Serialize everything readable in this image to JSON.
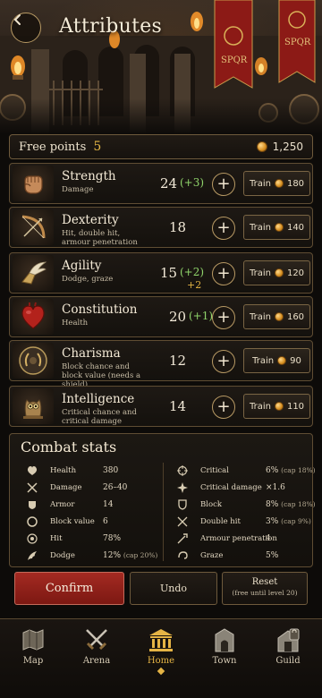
{
  "header": {
    "title": "Attributes",
    "back_icon": "chevron-left-icon"
  },
  "free_points": {
    "label": "Free points",
    "value": "5",
    "gold": "1,250"
  },
  "attributes": [
    {
      "name": "Strength",
      "desc": "Damage",
      "value": "24",
      "bonus": "(+3)",
      "subbonus": "",
      "train_label": "Train",
      "cost": "180",
      "icon": "fist-icon"
    },
    {
      "name": "Dexterity",
      "desc": "Hit, double hit, armour penetration",
      "value": "18",
      "bonus": "",
      "subbonus": "",
      "train_label": "Train",
      "cost": "140",
      "icon": "bow-icon"
    },
    {
      "name": "Agility",
      "desc": "Dodge, graze",
      "value": "15",
      "bonus": "(+2)",
      "subbonus": "+2",
      "train_label": "Train",
      "cost": "120",
      "icon": "winged-boot-icon"
    },
    {
      "name": "Constitution",
      "desc": "Health",
      "value": "20",
      "bonus": "(+1)",
      "subbonus": "",
      "train_label": "Train",
      "cost": "160",
      "icon": "heart-icon"
    },
    {
      "name": "Charisma",
      "desc": "Block chance and block value (needs a shield)",
      "value": "12",
      "bonus": "",
      "subbonus": "",
      "train_label": "Train",
      "cost": "90",
      "icon": "laurel-shield-icon"
    },
    {
      "name": "Intelligence",
      "desc": "Critical chance and critical damage",
      "value": "14",
      "bonus": "",
      "subbonus": "",
      "train_label": "Train",
      "cost": "110",
      "icon": "owl-icon"
    }
  ],
  "combat": {
    "title": "Combat stats",
    "left": [
      {
        "name": "Health",
        "value": "380",
        "cap": "",
        "icon": "heart-icon"
      },
      {
        "name": "Damage",
        "value": "26–40",
        "cap": "",
        "icon": "crossed-swords-icon"
      },
      {
        "name": "Armor",
        "value": "14",
        "cap": "",
        "icon": "armor-icon"
      },
      {
        "name": "Block value",
        "value": "6",
        "cap": "",
        "icon": "shield-icon"
      },
      {
        "name": "Hit",
        "value": "78%",
        "cap": "",
        "icon": "target-icon"
      },
      {
        "name": "Dodge",
        "value": "12%",
        "cap": "(cap 20%)",
        "icon": "wing-icon"
      }
    ],
    "right": [
      {
        "name": "Critical",
        "value": "6%",
        "cap": "(cap 18%)",
        "icon": "crosshair-icon"
      },
      {
        "name": "Critical damage",
        "value": "×1.6",
        "cap": "",
        "icon": "burst-icon"
      },
      {
        "name": "Block",
        "value": "8%",
        "cap": "(cap 18%)",
        "icon": "shield-icon"
      },
      {
        "name": "Double hit",
        "value": "3%",
        "cap": "(cap 9%)",
        "icon": "double-swords-icon"
      },
      {
        "name": "Armour penetration",
        "value": "4",
        "cap": "",
        "icon": "pierce-icon"
      },
      {
        "name": "Graze",
        "value": "5%",
        "cap": "",
        "icon": "swirl-icon"
      }
    ]
  },
  "actions": {
    "confirm": "Confirm",
    "undo": "Undo",
    "reset": "Reset",
    "reset_note": "(free until level 20)"
  },
  "nav": [
    {
      "label": "Map",
      "icon": "map-icon",
      "active": false
    },
    {
      "label": "Arena",
      "icon": "crossed-swords-icon",
      "active": false
    },
    {
      "label": "Home",
      "icon": "temple-icon",
      "active": true
    },
    {
      "label": "Town",
      "icon": "gate-icon",
      "active": false
    },
    {
      "label": "Guild",
      "icon": "guild-hall-icon",
      "active": false
    }
  ],
  "banners": [
    "SPQR",
    "SPQR"
  ],
  "colors": {
    "accent_gold": "#e5b445",
    "bonus_green": "#8fd36a",
    "confirm_red": "#a42a22"
  }
}
